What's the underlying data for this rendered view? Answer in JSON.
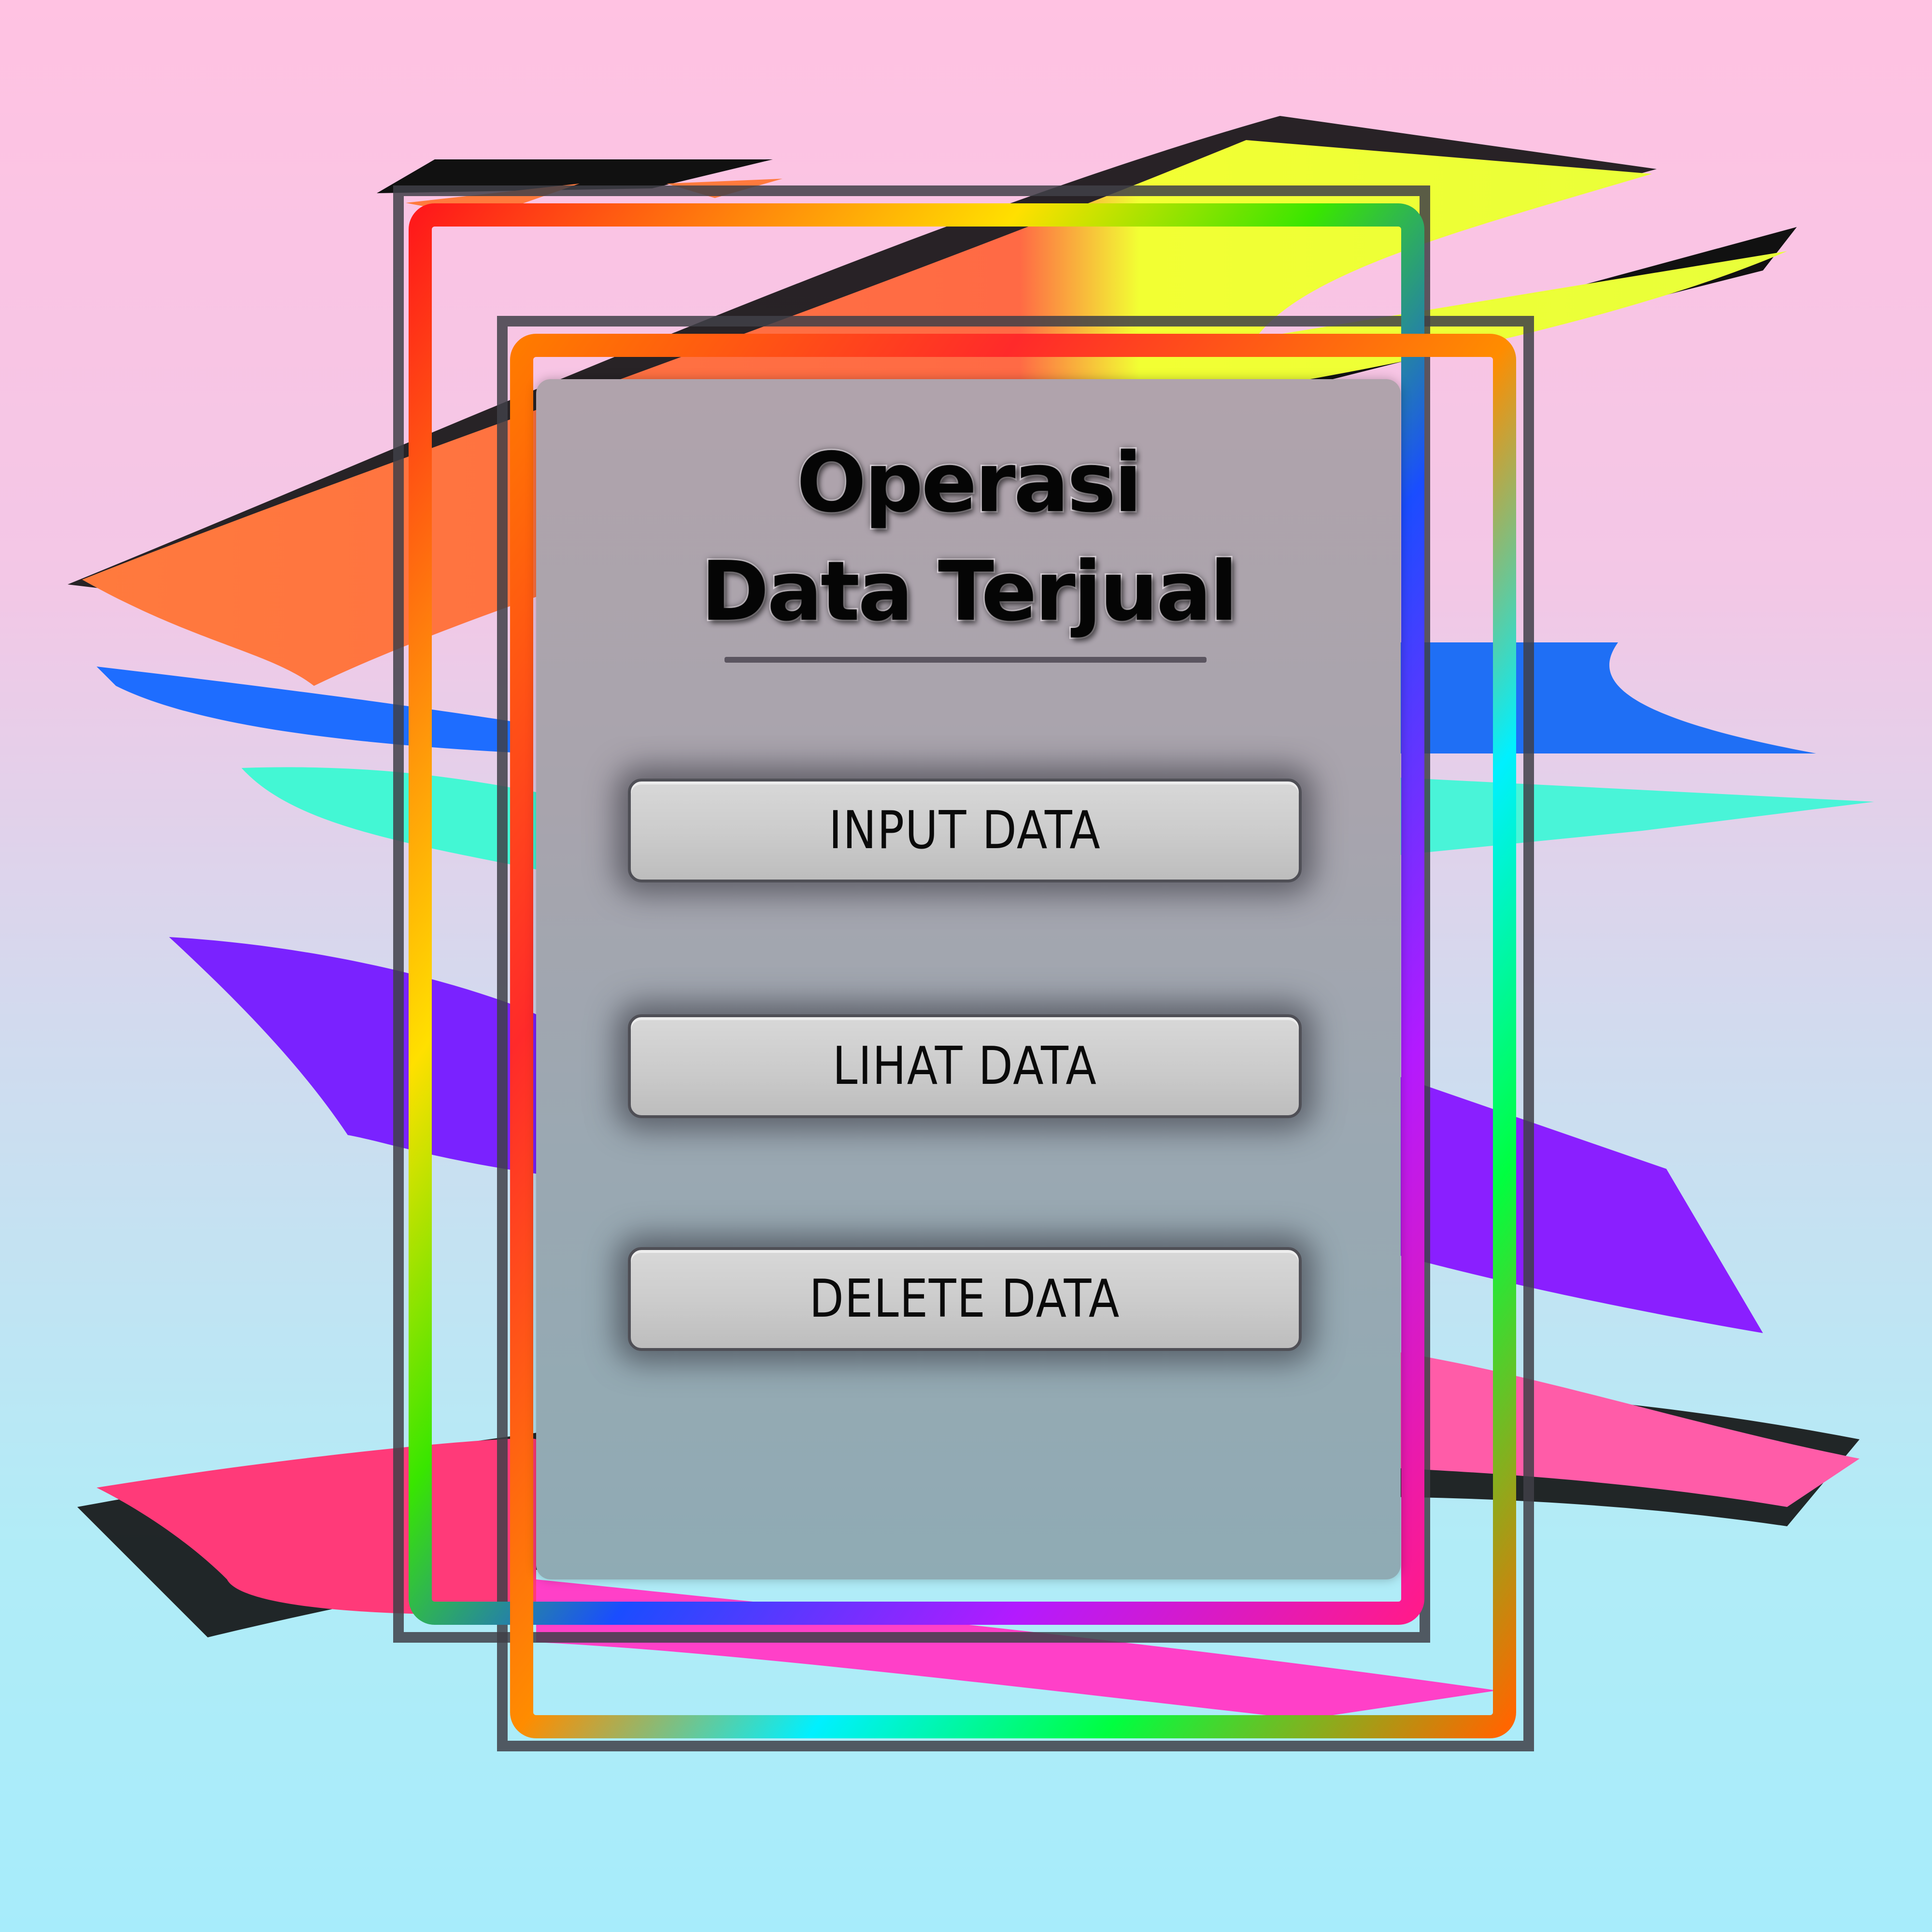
{
  "title": {
    "line1": "Operasi",
    "line2": "Data Terjual"
  },
  "buttons": {
    "input_label": "INPUT DATA",
    "view_label": "LIHAT DATA",
    "delete_label": "DELETE DATA"
  }
}
